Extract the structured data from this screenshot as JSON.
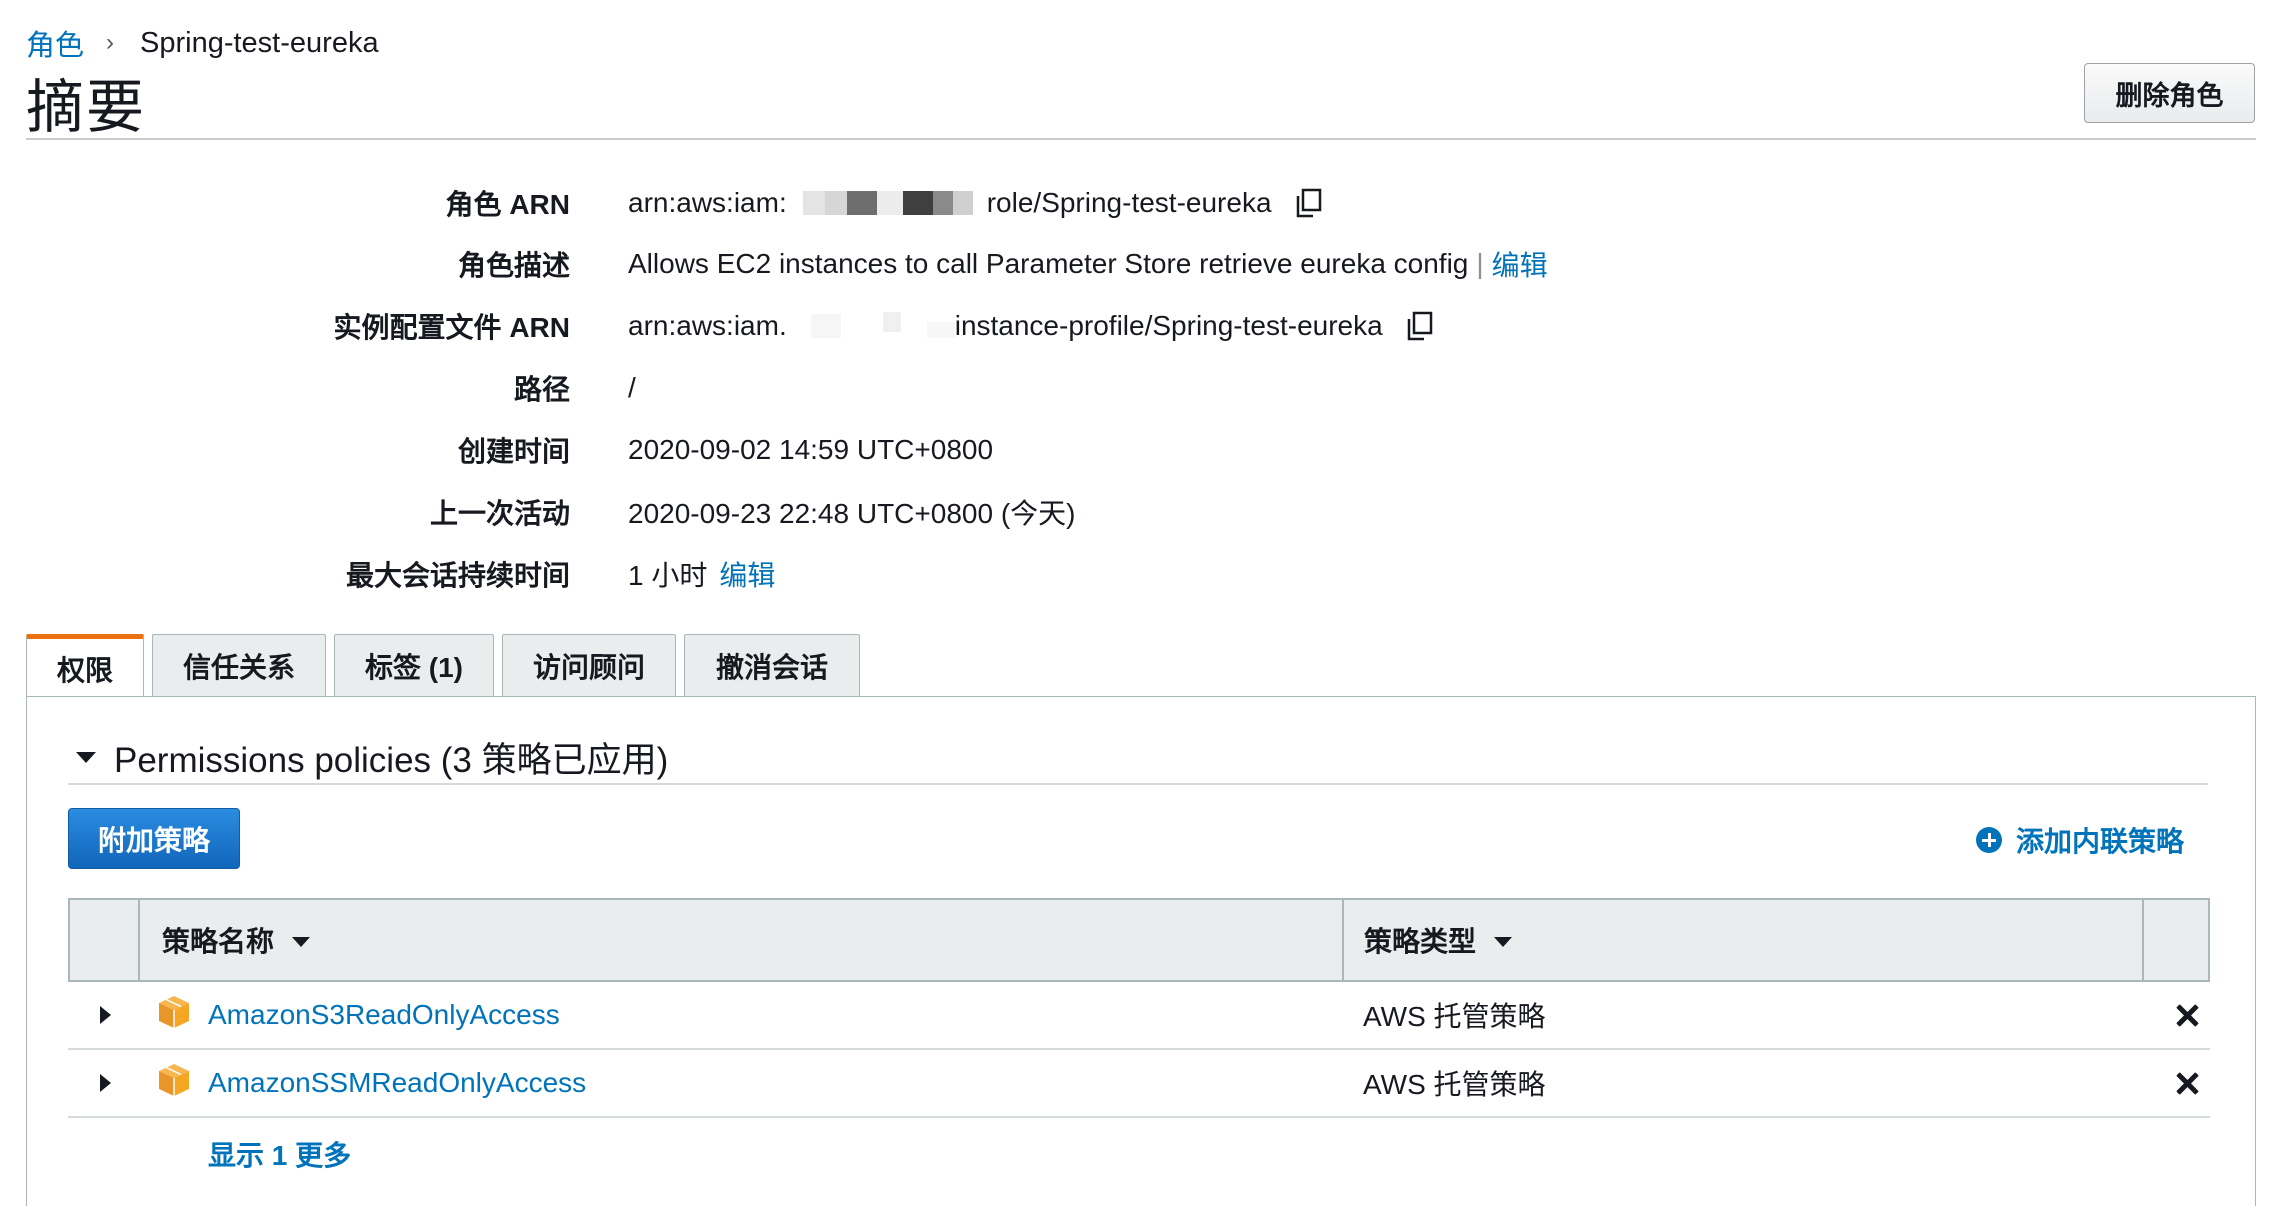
{
  "breadcrumb": {
    "parent": "角色",
    "separator": "›",
    "current": "Spring-test-eureka"
  },
  "page_title": "摘要",
  "delete_button": "删除角色",
  "summary": {
    "role_arn": {
      "label": "角色 ARN",
      "prefix": "arn:aws:iam:",
      "suffix": "role/Spring-test-eureka"
    },
    "description": {
      "label": "角色描述",
      "value": "Allows EC2 instances to call Parameter Store retrieve eureka config",
      "edit": "编辑"
    },
    "instance_profile_arn": {
      "label": "实例配置文件 ARN",
      "prefix": "arn:aws:iam.",
      "suffix": "instance-profile/Spring-test-eureka"
    },
    "path": {
      "label": "路径",
      "value": "/"
    },
    "created": {
      "label": "创建时间",
      "value": "2020-09-02 14:59 UTC+0800"
    },
    "last_activity": {
      "label": "上一次活动",
      "value": "2020-09-23 22:48 UTC+0800 (今天)"
    },
    "max_session": {
      "label": "最大会话持续时间",
      "value": "1 小时",
      "edit": "编辑"
    }
  },
  "tabs": [
    {
      "label": "权限",
      "active": true
    },
    {
      "label": "信任关系",
      "active": false
    },
    {
      "label": "标签 (1)",
      "active": false
    },
    {
      "label": "访问顾问",
      "active": false
    },
    {
      "label": "撤消会话",
      "active": false
    }
  ],
  "permissions": {
    "heading": "Permissions policies (3 策略已应用)",
    "attach_button": "附加策略",
    "add_inline": "添加内联策略",
    "table": {
      "columns": [
        "策略名称",
        "策略类型"
      ],
      "rows": [
        {
          "name": "AmazonS3ReadOnlyAccess",
          "type": "AWS 托管策略"
        },
        {
          "name": "AmazonSSMReadOnlyAccess",
          "type": "AWS 托管策略"
        }
      ]
    },
    "show_more": "显示 1 更多"
  },
  "colors": {
    "link": "#0073bb",
    "accent_tab": "#ec7211",
    "primary_button": "#1166bb",
    "policy_icon": "#f5a623"
  },
  "icons": {
    "copy": "copy-icon",
    "policy": "aws-policy-cube-icon",
    "remove": "close-icon",
    "add": "plus-circle-icon"
  }
}
